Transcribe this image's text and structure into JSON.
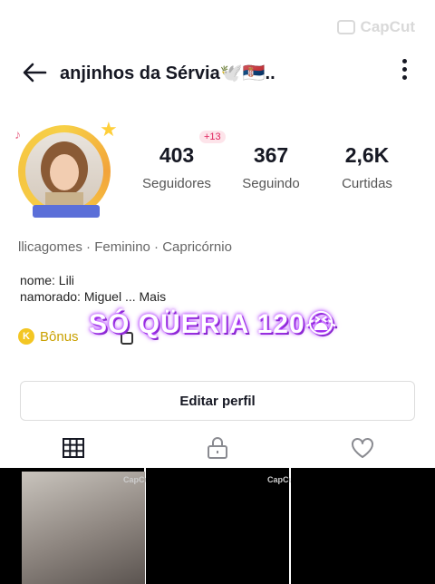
{
  "watermark": {
    "text": "CapCut"
  },
  "header": {
    "title": "anjinhos da Sérvia🕊️🇷🇸.."
  },
  "stats": [
    {
      "value": "403",
      "label": "Seguidores",
      "badge": "+13"
    },
    {
      "value": "367",
      "label": "Seguindo"
    },
    {
      "value": "2,6K",
      "label": "Curtidas"
    }
  ],
  "profile": {
    "meta": "llicagomes · Feminino · Capricórnio",
    "bio_line1": "nome: Lili",
    "bio_line2": "namorado: Miguel ...  Mais",
    "bonus_label": "Bônus",
    "coin_letter": "K"
  },
  "overlay_caption": "SÓ QÜERIA 120😭",
  "actions": {
    "edit_label": "Editar perfil"
  },
  "tabs": [
    {
      "icon": "grid-icon"
    },
    {
      "icon": "lock-icon"
    },
    {
      "icon": "heart-icon"
    }
  ],
  "grid": {
    "thumb_label": "CapCut"
  },
  "colors": {
    "accent_gold": "#f7d046",
    "badge_pink": "#e0245e",
    "overlay_glow": "#b23cff"
  }
}
